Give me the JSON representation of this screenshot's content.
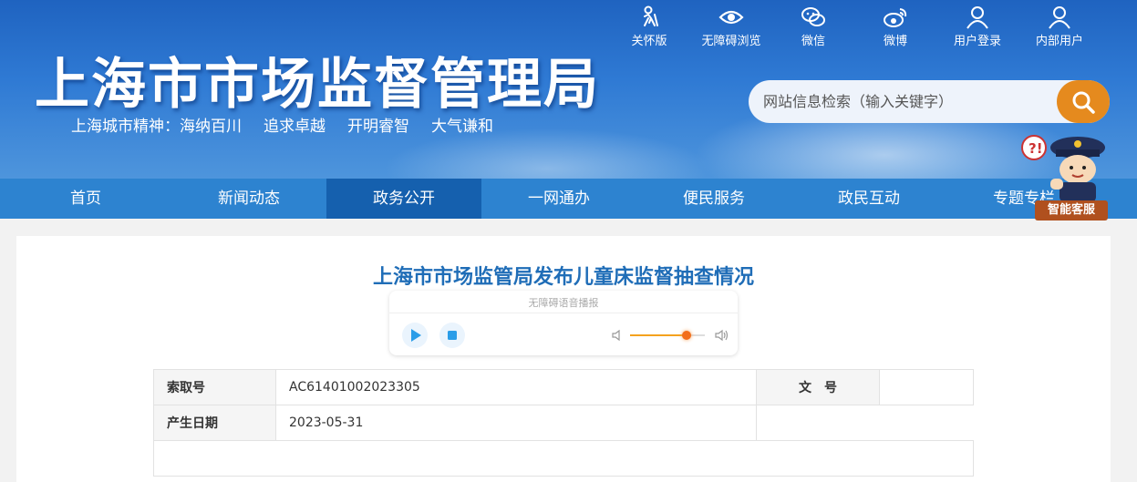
{
  "header": {
    "title": "上海市市场监督管理局",
    "slogan": [
      "上海城市精神：",
      "海纳百川",
      "追求卓越",
      "开明睿智",
      "大气谦和"
    ],
    "top_links": [
      {
        "label": "关怀版",
        "icon": "elder-care-icon"
      },
      {
        "label": "无障碍浏览",
        "icon": "eye-icon"
      },
      {
        "label": "微信",
        "icon": "wechat-icon"
      },
      {
        "label": "微博",
        "icon": "weibo-icon"
      },
      {
        "label": "用户登录",
        "icon": "user-icon"
      },
      {
        "label": "内部用户",
        "icon": "user-icon"
      }
    ],
    "search_placeholder": "网站信息检索（输入关键字）",
    "robot_label": "智能客服"
  },
  "nav": {
    "items": [
      "首页",
      "新闻动态",
      "政务公开",
      "一网通办",
      "便民服务",
      "政民互动",
      "专题专栏"
    ],
    "active": "政务公开"
  },
  "article": {
    "title": "上海市市场监管局发布儿童床监督抽查情况",
    "player": {
      "label": "无障碍语音播报",
      "volume": 0.75
    }
  },
  "meta": {
    "index_label": "索取号",
    "index_value": "AC61401002023305",
    "doc_no_label": "文　号",
    "doc_no_value": "",
    "date_label": "产生日期",
    "date_value": "2023-05-31"
  },
  "colors": {
    "primary_blue": "#2d83d0",
    "active_nav": "#1560ae",
    "title_blue": "#1f6db7",
    "search_orange": "#e58a1e"
  }
}
